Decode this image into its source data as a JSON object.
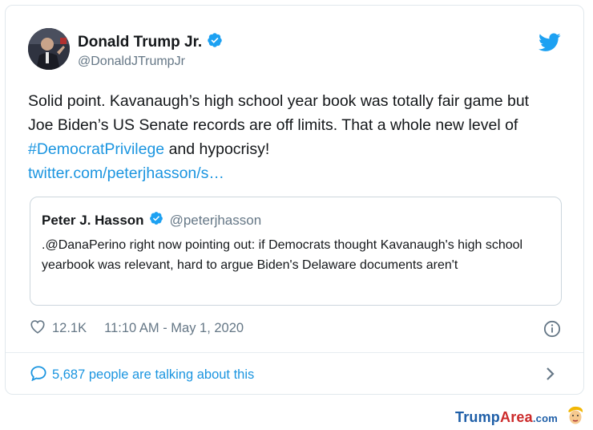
{
  "author": {
    "name": "Donald Trump Jr.",
    "handle": "@DonaldJTrumpJr"
  },
  "tweet": {
    "text_main": "Solid point. Kavanaugh’s high school year book was totally fair game but Joe Biden’s US Senate records are off limits. That a whole new level of ",
    "hashtag": "#DemocratPrivilege",
    "text_after": " and hypocrisy!",
    "link": "twitter.com/peterjhasson/s…"
  },
  "quoted": {
    "name": "Peter J. Hasson",
    "handle": "@peterjhasson",
    "text": ".@DanaPerino right now pointing out: if Democrats thought Kavanaugh's high school yearbook was relevant, hard to argue Biden's Delaware documents aren't"
  },
  "meta": {
    "likes": "12.1K",
    "timestamp": "11:10 AM - May 1, 2020"
  },
  "conversation": {
    "label": "5,687 people are talking about this"
  },
  "watermark": {
    "brand_part1": "Trump",
    "brand_part2": "Area",
    "brand_suffix": ".com"
  },
  "colors": {
    "link": "#1b95e0",
    "verified": "#1da1f2",
    "muted": "#657786"
  },
  "icons": [
    "verified-badge-icon",
    "twitter-bird-icon",
    "heart-icon",
    "info-icon",
    "comment-icon",
    "chevron-right-icon"
  ]
}
